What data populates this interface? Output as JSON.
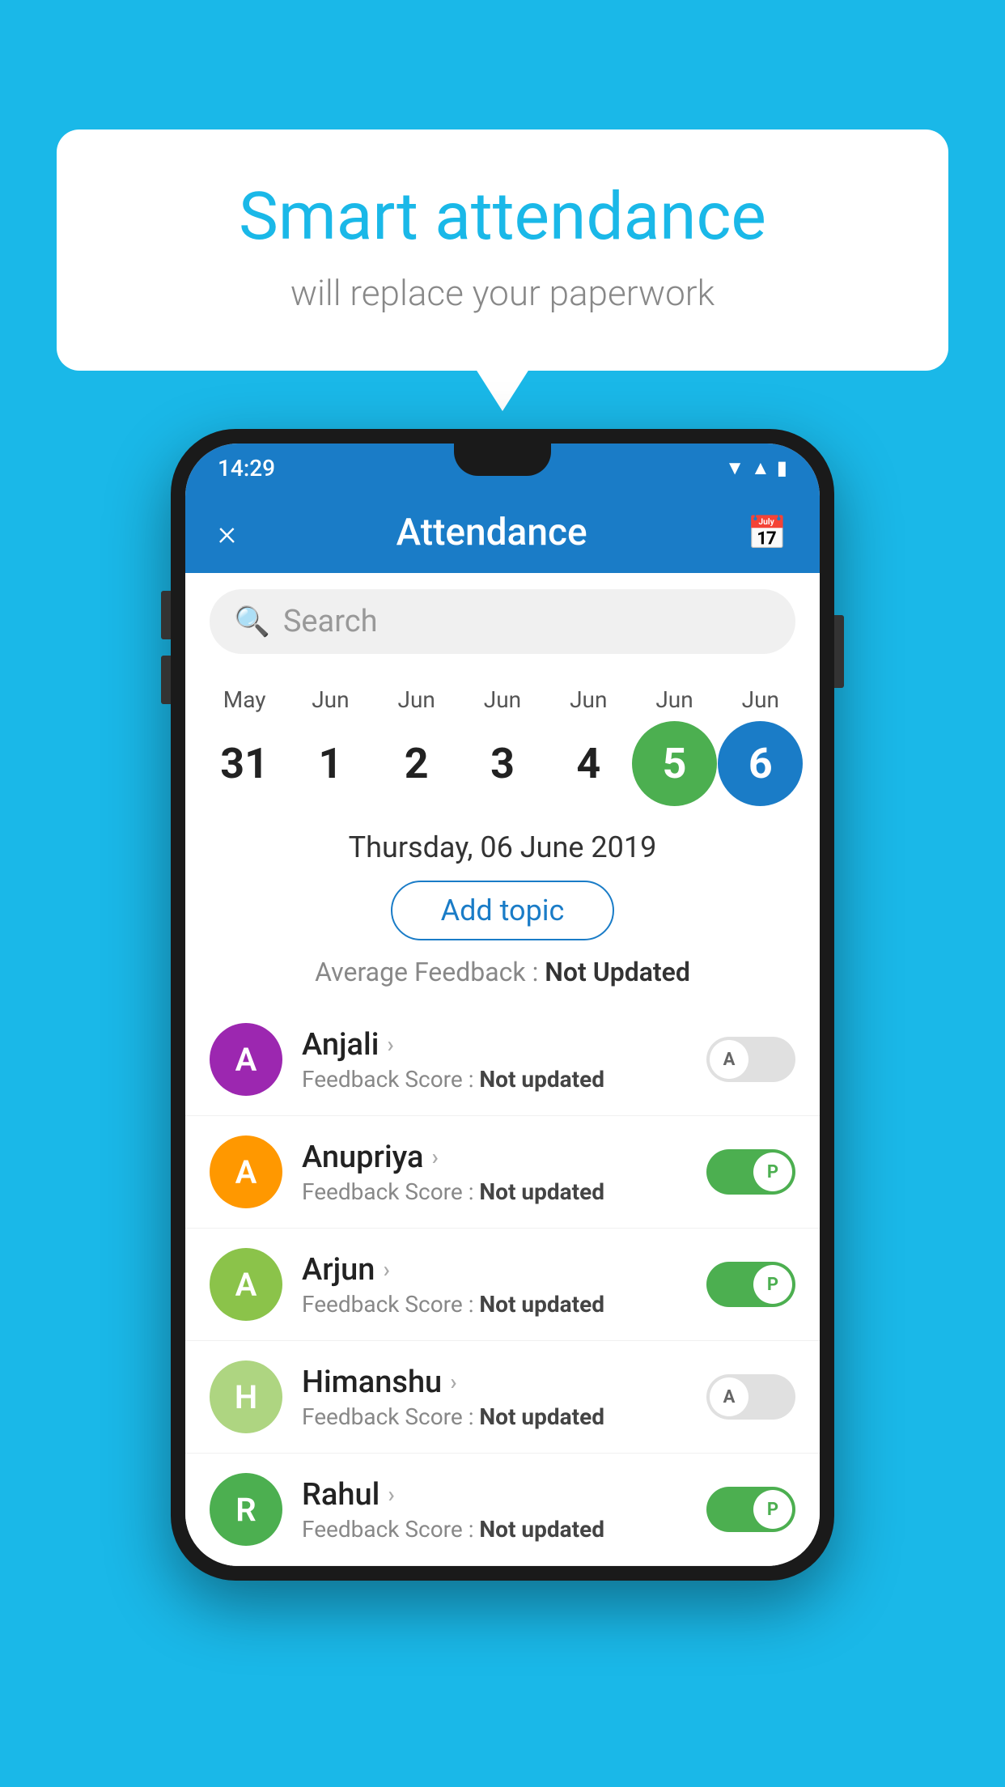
{
  "background_color": "#1ab8e8",
  "speech_bubble": {
    "title": "Smart attendance",
    "subtitle": "will replace your paperwork"
  },
  "status_bar": {
    "time": "14:29",
    "icons": "▼▲▮"
  },
  "app_header": {
    "title": "Attendance",
    "close_label": "×",
    "calendar_icon": "📅"
  },
  "search": {
    "placeholder": "Search"
  },
  "calendar": {
    "months": [
      "May",
      "Jun",
      "Jun",
      "Jun",
      "Jun",
      "Jun",
      "Jun"
    ],
    "dates": [
      "31",
      "1",
      "2",
      "3",
      "4",
      "5",
      "6"
    ],
    "selected_green": "5",
    "selected_blue": "6"
  },
  "info": {
    "date_label": "Thursday, 06 June 2019",
    "add_topic_label": "Add topic",
    "feedback_prefix": "Average Feedback : ",
    "feedback_value": "Not Updated"
  },
  "students": [
    {
      "name": "Anjali",
      "avatar_letter": "A",
      "avatar_color": "#9c27b0",
      "feedback": "Feedback Score : ",
      "feedback_value": "Not updated",
      "toggle_state": "off",
      "toggle_label": "A"
    },
    {
      "name": "Anupriya",
      "avatar_letter": "A",
      "avatar_color": "#ff9800",
      "feedback": "Feedback Score : ",
      "feedback_value": "Not updated",
      "toggle_state": "on",
      "toggle_label": "P"
    },
    {
      "name": "Arjun",
      "avatar_letter": "A",
      "avatar_color": "#8bc34a",
      "feedback": "Feedback Score : ",
      "feedback_value": "Not updated",
      "toggle_state": "on",
      "toggle_label": "P"
    },
    {
      "name": "Himanshu",
      "avatar_letter": "H",
      "avatar_color": "#aed581",
      "feedback": "Feedback Score : ",
      "feedback_value": "Not updated",
      "toggle_state": "off",
      "toggle_label": "A"
    },
    {
      "name": "Rahul",
      "avatar_letter": "R",
      "avatar_color": "#4caf50",
      "feedback": "Feedback Score : ",
      "feedback_value": "Not updated",
      "toggle_state": "on",
      "toggle_label": "P"
    }
  ]
}
